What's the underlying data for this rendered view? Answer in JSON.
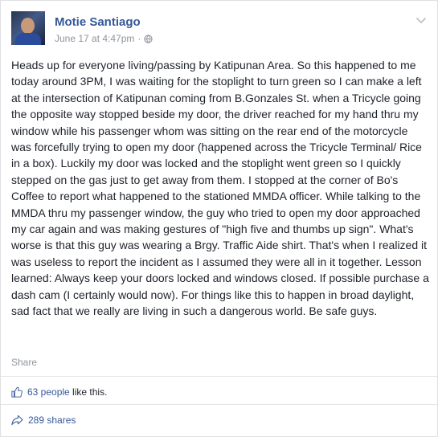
{
  "post": {
    "author": "Motie Santiago",
    "date": "June 17 at 4:47pm",
    "separator": "·",
    "body": "Heads up for everyone living/passing by Katipunan Area. So this happened to me today around 3PM, I was waiting for the stoplight to turn green so I can make a left at the intersection of Katipunan coming from B.Gonzales St. when a Tricycle going the opposite way stopped beside my door, the driver reached for my hand thru my window while his passenger whom was sitting on the rear end of the motorcycle was forcefully trying to open my door (happened across the Tricycle Terminal/ Rice in a box). Luckily my door was locked and the stoplight went green so I quickly stepped on the gas just to get away from them. I stopped at the corner of Bo's Coffee to report what happened to the stationed MMDA officer. While talking to the MMDA thru my passenger window, the guy who tried to open my door approached my car again and was making gestures of \"high five and thumbs up sign\". What's worse is that this guy was wearing a Brgy. Traffic Aide shirt. That's when I realized it was useless to report the incident as I assumed they were all in it together. Lesson learned: Always keep your doors locked and windows closed. If possible purchase a dash cam (I certainly would now). For things like this to happen in broad daylight, sad fact that we really are living in such a dangerous world. Be safe guys.",
    "share_label": "Share",
    "privacy_icon": "globe-icon",
    "menu_icon": "chevron-down-icon"
  },
  "stats": {
    "likes_count": "63 people",
    "likes_suffix": " like this.",
    "shares": "289 shares",
    "like_icon": "thumbs-up-icon",
    "share_icon": "share-arrow-icon"
  },
  "colors": {
    "link": "#365899",
    "meta": "#90949c",
    "text": "#1d2129"
  }
}
